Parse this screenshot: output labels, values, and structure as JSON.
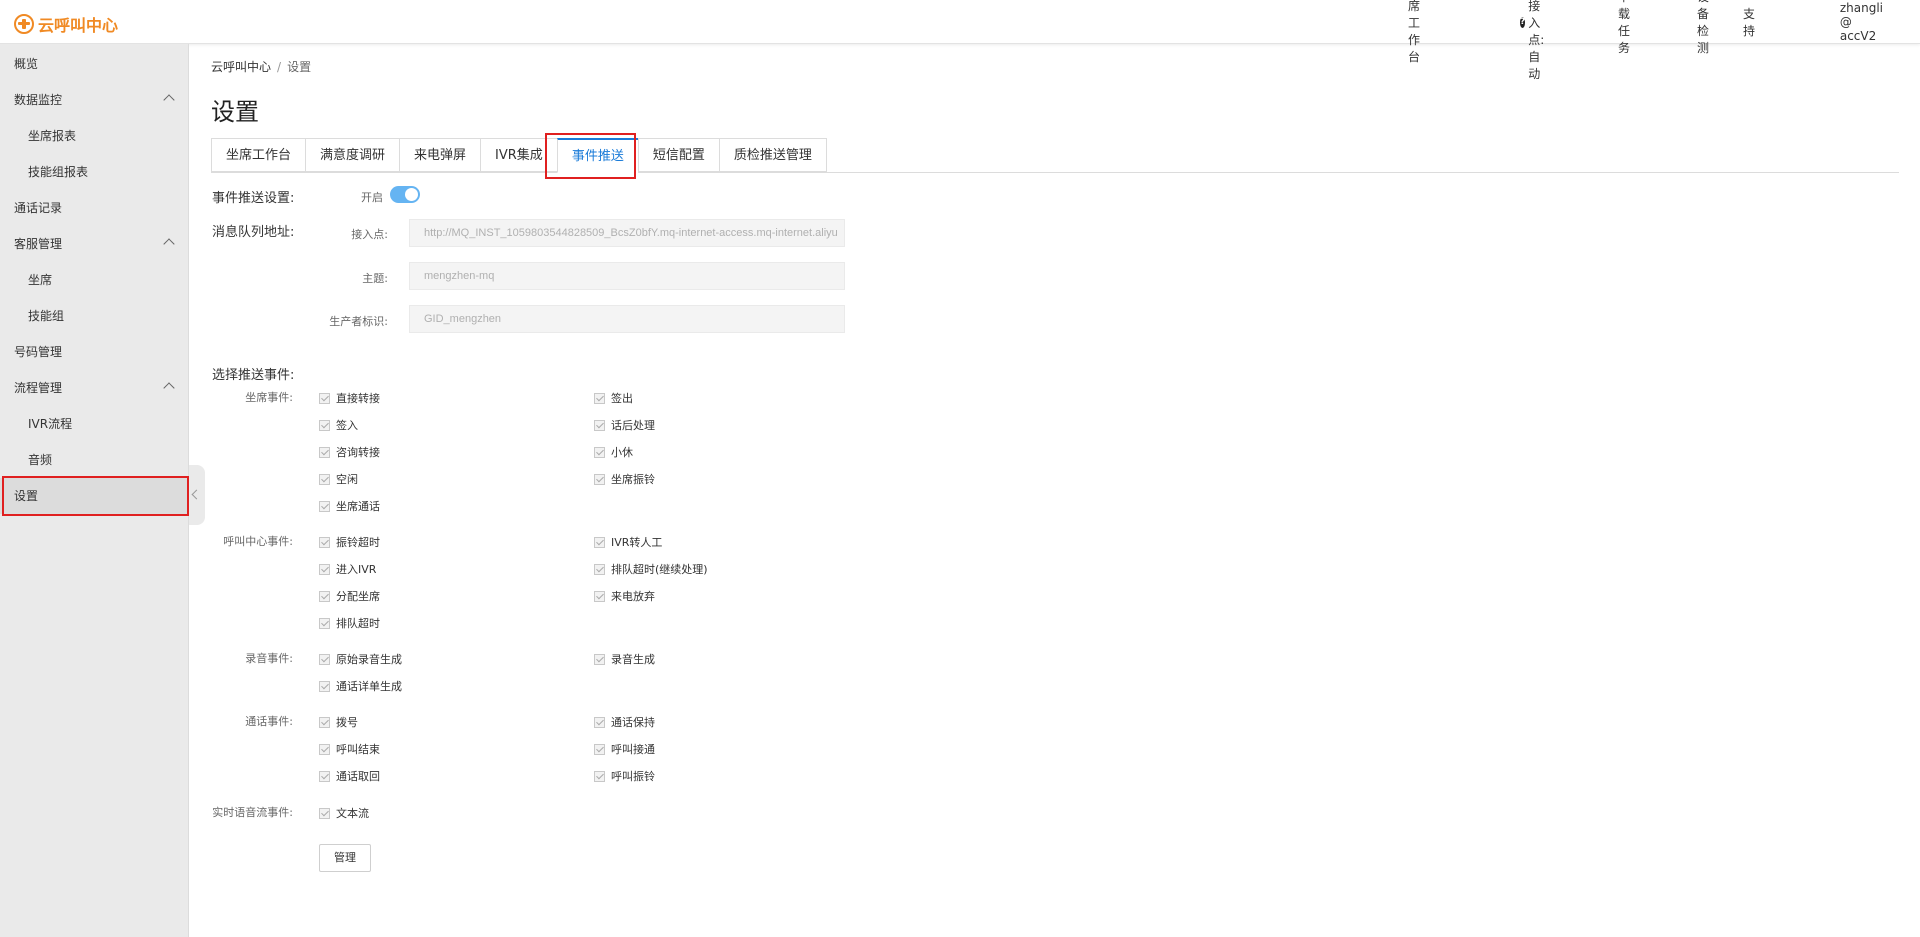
{
  "brand": {
    "name": "云呼叫中心",
    "accent": "#f08a24"
  },
  "topnav": {
    "workbench": "坐席工作台",
    "access_point": "坐席接入点:自动",
    "download": "下载任务",
    "device_check": "设备检测",
    "support": "支持",
    "user": "zhangli @ accV2"
  },
  "sidebar": {
    "overview": "概览",
    "data_monitor": "数据监控",
    "agent_report": "坐席报表",
    "skillgroup_report": "技能组报表",
    "call_records": "通话记录",
    "cs_mgmt": "客服管理",
    "agents": "坐席",
    "skillgroups": "技能组",
    "number_mgmt": "号码管理",
    "flow_mgmt": "流程管理",
    "ivr_flow": "IVR流程",
    "audio": "音频",
    "settings": "设置"
  },
  "breadcrumb": {
    "root": "云呼叫中心",
    "sep": "/",
    "current": "设置"
  },
  "page_title": "设置",
  "tabs": [
    "坐席工作台",
    "满意度调研",
    "来电弹屏",
    "IVR集成",
    "事件推送",
    "短信配置",
    "质检推送管理"
  ],
  "active_tab": "事件推送",
  "form": {
    "push_setting_label": "事件推送设置:",
    "toggle_label": "开启",
    "mq_label": "消息队列地址:",
    "endpoint_label": "接入点:",
    "endpoint_value": "http://MQ_INST_1059803544828509_BcsZ0bfY.mq-internet-access.mq-internet.aliyu",
    "topic_label": "主题:",
    "topic_value": "mengzhen-mq",
    "producer_label": "生产者标识:",
    "producer_value": "GID_mengzhen",
    "select_events_label": "选择推送事件:",
    "agent_events_label": "坐席事件:",
    "agent_events": [
      "直接转接",
      "签出",
      "签入",
      "话后处理",
      "咨询转接",
      "小休",
      "空闲",
      "坐席振铃",
      "坐席通话"
    ],
    "callcenter_events_label": "呼叫中心事件:",
    "callcenter_events": [
      "振铃超时",
      "IVR转人工",
      "进入IVR",
      "排队超时(继续处理)",
      "分配坐席",
      "来电放弃",
      "排队超时"
    ],
    "recording_events_label": "录音事件:",
    "recording_events": [
      "原始录音生成",
      "录音生成",
      "通话详单生成"
    ],
    "call_events_label": "通话事件:",
    "call_events": [
      "拨号",
      "通话保持",
      "呼叫结束",
      "呼叫接通",
      "通话取回",
      "呼叫振铃"
    ],
    "stream_events_label": "实时语音流事件:",
    "stream_events": [
      "文本流"
    ],
    "manage_button": "管理"
  },
  "colors": {
    "tab_active": "#1a7bd8",
    "toggle_on": "#65b4f2",
    "highlight_box": "#e02020"
  }
}
